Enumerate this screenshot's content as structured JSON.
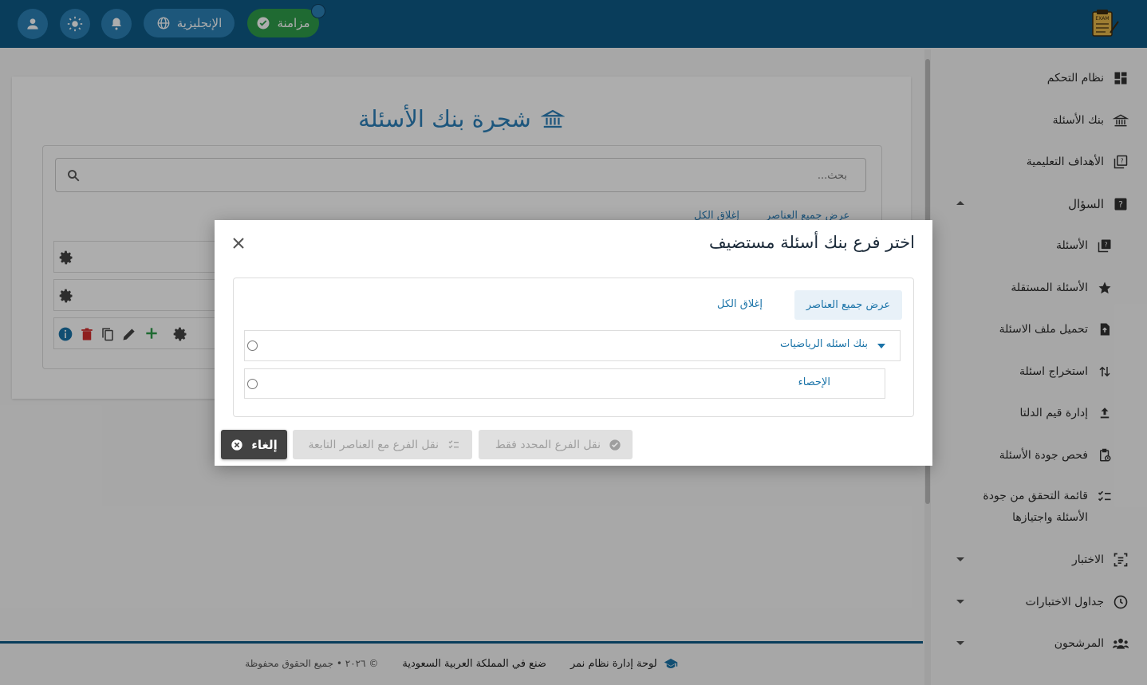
{
  "topbar": {
    "sync_label": "مزامنة",
    "language_label": "الإنجليزية",
    "logo_icon": "exam-logo-icon"
  },
  "sidebar": {
    "items": [
      {
        "label": "نظام التحكم",
        "icon": "dashboard-icon"
      },
      {
        "label": "بنك الأسئلة",
        "icon": "bank-icon"
      },
      {
        "label": "الأهداف التعليمية",
        "icon": "objectives-icon"
      },
      {
        "label": "السؤال",
        "icon": "question-icon",
        "expanded": true
      },
      {
        "label": "الأسئلة",
        "icon": "questions-icon"
      },
      {
        "label": "الأسئلة المستقلة",
        "icon": "star-icon"
      },
      {
        "label": "تحميل ملف الاسئلة",
        "icon": "file-upload-icon"
      },
      {
        "label": "استخراج اسئلة",
        "icon": "sort-arrows-icon"
      },
      {
        "label": "إدارة قيم الدلتا",
        "icon": "upload-icon"
      },
      {
        "label": "فحص جودة الأسئلة",
        "icon": "clipboard-clock-icon"
      },
      {
        "label": "قائمة التحقق من جودة",
        "label2": "الأسئلة واجتيازها",
        "icon": "checklist-icon"
      },
      {
        "label": "الاختبار",
        "icon": "exam-frame-icon"
      },
      {
        "label": "جداول الاختبارات",
        "icon": "clock-icon"
      },
      {
        "label": "المرشحون",
        "icon": "people-icon"
      }
    ]
  },
  "main": {
    "title": "شجرة بنك الأسئلة",
    "search_placeholder": "بحث...",
    "show_all": "عرض جميع العناصر",
    "close_all": "إغلاق الكل"
  },
  "modal": {
    "title": "اختر فرع بنك أسئلة مستضيف",
    "show_all": "عرض جميع العناصر",
    "close_all": "إغلاق الكل",
    "tree": [
      {
        "label": "بنك اسئله الرياضيات",
        "expanded": true
      },
      {
        "label": "الإحصاء",
        "child": true
      }
    ],
    "btn_move_selected": "نقل الفرع المحدد فقط",
    "btn_move_with_children": "نقل الفرع مع العناصر التابعة",
    "btn_cancel": "إلغاء"
  },
  "footer": {
    "brand": "لوحة إدارة نظام نمر",
    "made_in": "ضنع في المملكة العربية السعودية",
    "copyright": "© ٢٠٢٦ • جميع الحقوق محفوظة"
  },
  "colors": {
    "topbar": "#0e5a86",
    "accent": "#1a73a8",
    "sync_green": "#2e9d4a",
    "title_blue": "#2b7fb8",
    "cancel_dark": "#424242"
  }
}
